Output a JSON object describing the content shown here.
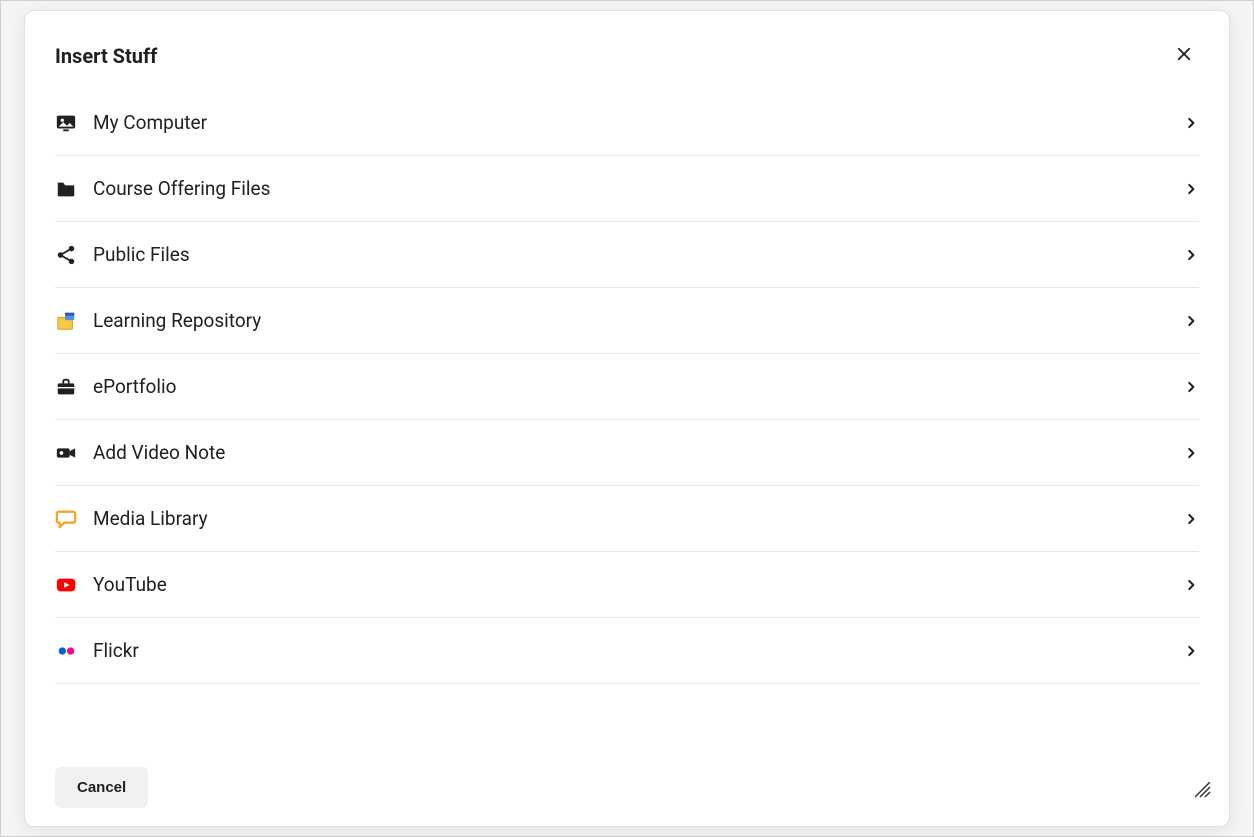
{
  "dialog": {
    "title": "Insert Stuff",
    "cancel_label": "Cancel"
  },
  "sources": [
    {
      "id": "my-computer",
      "label": "My Computer",
      "icon": "image-icon"
    },
    {
      "id": "course-offering-files",
      "label": "Course Offering Files",
      "icon": "folder-icon"
    },
    {
      "id": "public-files",
      "label": "Public Files",
      "icon": "share-icon"
    },
    {
      "id": "learning-repository",
      "label": "Learning Repository",
      "icon": "repository-icon"
    },
    {
      "id": "eportfolio",
      "label": "ePortfolio",
      "icon": "briefcase-icon"
    },
    {
      "id": "add-video-note",
      "label": "Add Video Note",
      "icon": "video-camera-icon"
    },
    {
      "id": "media-library",
      "label": "Media Library",
      "icon": "chat-bubble-icon"
    },
    {
      "id": "youtube",
      "label": "YouTube",
      "icon": "youtube-icon"
    },
    {
      "id": "flickr",
      "label": "Flickr",
      "icon": "flickr-icon"
    }
  ]
}
